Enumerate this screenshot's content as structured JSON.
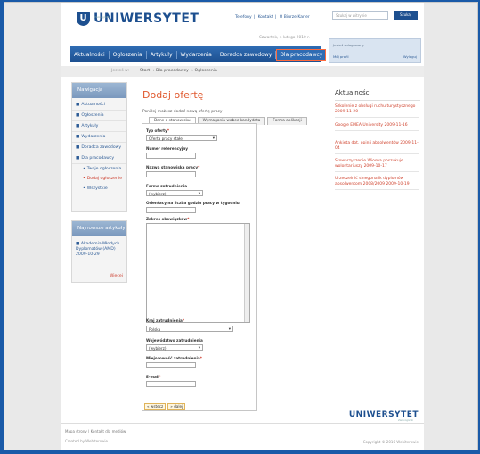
{
  "header": {
    "logo_mark": "U",
    "logo_text": "UNIWERSYTET",
    "logo_sub": "Zielonogórski",
    "top_links": [
      "Telefony",
      "Kontakt",
      "O Biurze Karier"
    ],
    "date": "Czwartek, 4 lutego 2010 r.",
    "search_placeholder": "Szukaj w witrynie",
    "search_button": "Szukaj",
    "login": {
      "user_label": "Jesteś zalogowany",
      "profile": "Mój profil",
      "logout": "Wyloguj"
    },
    "nav": [
      "Aktualności",
      "Ogłoszenia",
      "Artykuły",
      "Wydarzenia",
      "Doradca zawodowy",
      "Dla pracodawcy"
    ]
  },
  "breadcrumb": {
    "label": "Jesteś w:",
    "path": "Start → Dla pracodawcy → Ogłoszenia"
  },
  "sidebar": {
    "nav_title": "Nawigacja",
    "items": [
      "Aktualności",
      "Ogłoszenia",
      "Artykuły",
      "Wydarzenia",
      "Doradca zawodowy",
      "Dla pracodawcy"
    ],
    "subitems": [
      "Twoje ogłoszenia",
      "Dodaj ogłoszenie",
      "Wszystkie"
    ],
    "news_title": "Najnowsze artykuły",
    "news_item": "Akademia Młodych Dyplomatów (AMD) 2009-10-29",
    "news_more": "Więcej"
  },
  "main": {
    "title": "Dodaj ofertę",
    "intro": "Poniżej możesz dodać nową ofertę pracy",
    "tabs": [
      "Dane o stanowisku",
      "Wymagania wobec kandydata",
      "Forma aplikacji"
    ],
    "fields": {
      "type_label": "Typ oferty",
      "type_value": "Oferta pracy stałej",
      "ref_label": "Numer referencyjny",
      "position_label": "Nazwa stanowiska pracy",
      "employment_label": "Forma zatrudnienia",
      "employment_value": "(wybierz)",
      "hours_label": "Orientacyjna liczba godzin pracy w tygodniu",
      "duties_label": "Zakres obowiązków",
      "country_label": "Kraj zatrudnienia",
      "country_value": "Polska",
      "voivodeship_label": "Województwo zatrudnienia",
      "voivodeship_value": "(wybierz)",
      "city_label": "Miejscowość zatrudnienia",
      "email_label": "E-mail",
      "required_mark": "*"
    },
    "buttons": [
      "« wstecz",
      "» dalej"
    ]
  },
  "news": {
    "title": "Aktualności",
    "items": [
      "Szkolenie z obsługi ruchu turystycznego 2009-11-20",
      "Google EMEA University 2009-11-16",
      "Ankieta dot. opinii absolwentów 2009-11-04",
      "Stowarzyszenie Wiosna poszukuje wolontariuszy 2009-10-17",
      "Urzeczelnić sinegonalik dyplomów absolwentom 2008/2009 2009-10-19"
    ]
  },
  "footer": {
    "links": [
      "Mapa strony",
      "Kontakt dla mediów"
    ],
    "created": "Created by Webiterowie",
    "logo_text": "UNIWERSYTET",
    "logo_sub": "Zielonogórski",
    "copyright": "Copyright © 2010 Webiterowie"
  }
}
